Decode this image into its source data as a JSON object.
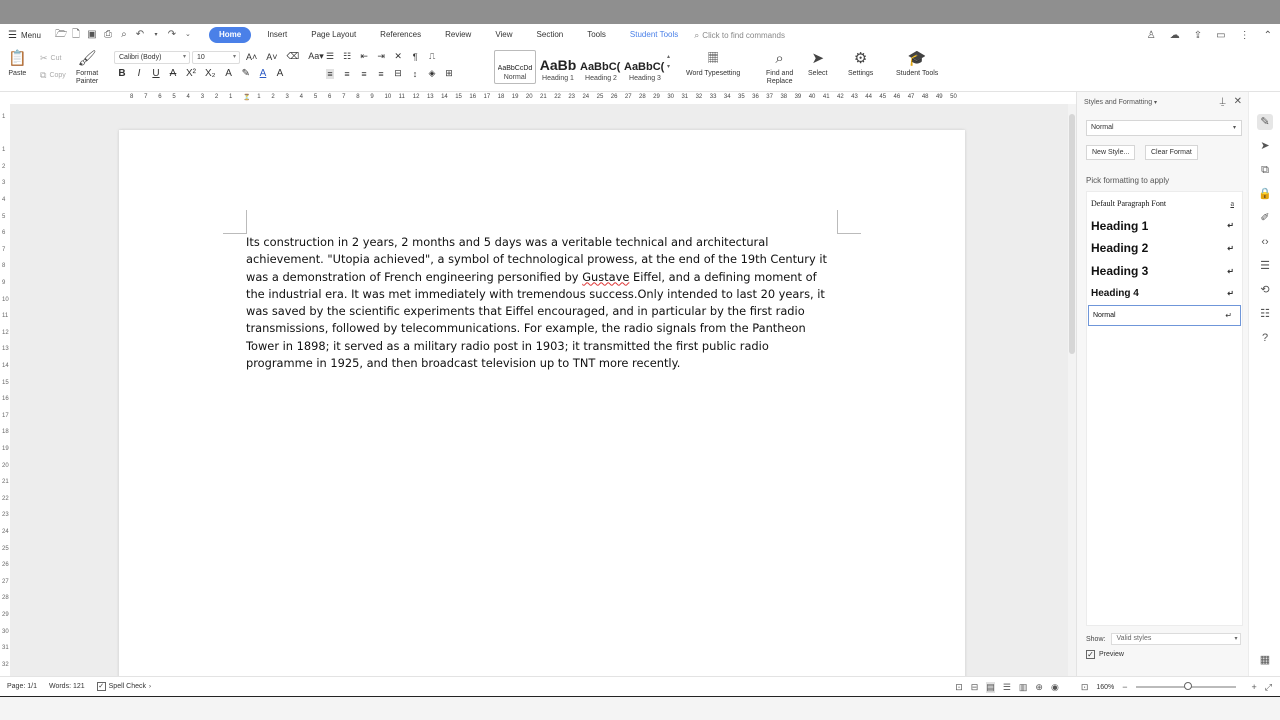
{
  "menu": {
    "label": "Menu",
    "tabs": [
      "Home",
      "Insert",
      "Page Layout",
      "References",
      "Review",
      "View",
      "Section",
      "Tools"
    ],
    "active_tab": "Home",
    "student_tools": "Student Tools",
    "find_commands": "Click to find commands"
  },
  "ribbon": {
    "paste": "Paste",
    "cut": "Cut",
    "copy": "Copy",
    "format_painter_1": "Format",
    "format_painter_2": "Painter",
    "font_name": "Calibri (Body)",
    "font_size": "10",
    "styles": [
      {
        "sample": "AaBbCcDd",
        "name": "Normal"
      },
      {
        "sample": "AaBb",
        "name": "Heading 1"
      },
      {
        "sample": "AaBbC(",
        "name": "Heading 2"
      },
      {
        "sample": "AaBbC(",
        "name": "Heading 3"
      }
    ],
    "word_typesetting": "Word Typesetting",
    "find_replace_1": "Find and",
    "find_replace_2": "Replace",
    "select": "Select",
    "settings": "Settings",
    "student_tools": "Student Tools"
  },
  "ruler": {
    "numbers": [
      "8",
      "7",
      "6",
      "5",
      "4",
      "3",
      "2",
      "1",
      "",
      "1",
      "2",
      "3",
      "4",
      "5",
      "6",
      "7",
      "8",
      "9",
      "10",
      "11",
      "12",
      "13",
      "14",
      "15",
      "16",
      "17",
      "18",
      "19",
      "20",
      "21",
      "22",
      "23",
      "24",
      "25",
      "26",
      "27",
      "28",
      "29",
      "30",
      "31",
      "32",
      "33",
      "34",
      "35",
      "36",
      "37",
      "38",
      "39",
      "40",
      "41",
      "42",
      "43",
      "44",
      "45",
      "46",
      "47",
      "48",
      "49",
      "50"
    ],
    "vertical": [
      "1",
      "",
      "1",
      "2",
      "3",
      "4",
      "5",
      "6",
      "7",
      "8",
      "9",
      "10",
      "11",
      "12",
      "13",
      "14",
      "15",
      "16",
      "17",
      "18",
      "19",
      "20",
      "21",
      "22",
      "23",
      "24",
      "25",
      "26",
      "27",
      "28",
      "29",
      "30",
      "31",
      "32",
      "33"
    ]
  },
  "document": {
    "lines": [
      [
        "Its construction in 2 years, 2 months and 5 days was a veritable technical and architectural"
      ],
      [
        "achievement. \"Utopia achieved\", a symbol of technological prowess, at the end of the 19th Century it"
      ],
      [
        "was a demonstration of French engineering personified by ",
        "Gustave",
        " Eiffel, and a defining moment of"
      ],
      [
        "the industrial era. It was met immediately with tremendous success.Only intended to last 20 years, it"
      ],
      [
        "was saved by the scientific experiments that Eiffel encouraged, and in particular by the first radio"
      ],
      [
        "transmissions, followed by telecommunications. For example, the radio signals from the Pantheon"
      ],
      [
        "Tower in 1898; it served as a military radio post in 1903; it transmitted the first public radio"
      ],
      [
        "programme in 1925, and then broadcast television up to TNT more recently."
      ]
    ]
  },
  "panel": {
    "title": "Styles and Formatting",
    "current_style": "Normal",
    "new_style": "New Style...",
    "clear_format": "Clear Format",
    "pick_label": "Pick formatting to apply",
    "items": [
      {
        "label": "Default Paragraph Font",
        "mark": "a"
      },
      {
        "label": "Heading 1",
        "mark": "↵"
      },
      {
        "label": "Heading 2",
        "mark": "↵"
      },
      {
        "label": "Heading 3",
        "mark": "↵"
      },
      {
        "label": "Heading 4",
        "mark": "↵"
      },
      {
        "label": "Normal",
        "mark": "↵"
      }
    ],
    "show_label": "Show:",
    "show_value": "Valid styles",
    "preview_label": "Preview"
  },
  "status": {
    "page": "Page: 1/1",
    "words": "Words: 121",
    "spell_check": "Spell Check",
    "zoom": "160%"
  }
}
